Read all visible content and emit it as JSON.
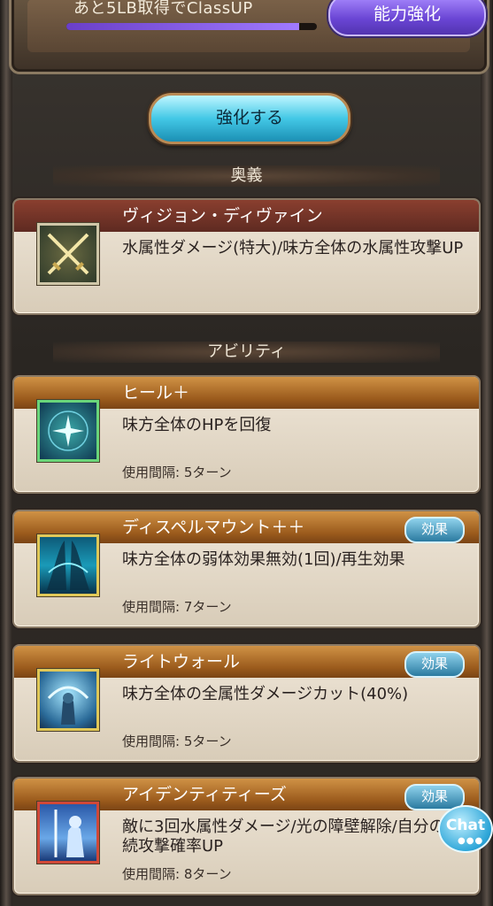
{
  "top": {
    "class_up_text": "あと5LB取得でClassUP",
    "progress_fraction": 0.93,
    "ability_button_label": "能力強化"
  },
  "enhance_button_label": "強化する",
  "sections": {
    "ougi_title": "奥義",
    "ability_title": "アビリティ"
  },
  "ougi": {
    "name": "ヴィジョン・ディヴァイン",
    "description": "水属性ダメージ(特大)/味方全体の水属性攻撃UP",
    "icon": "crossed-swords-icon"
  },
  "abilities": [
    {
      "name": "ヒール＋",
      "description": "味方全体のHPを回復",
      "interval": "使用間隔: 5ターン",
      "icon": "heal-sparkle-icon",
      "has_effect_button": false
    },
    {
      "name": "ディスペルマウント＋＋",
      "description": "味方全体の弱体効果無効(1回)/再生効果",
      "interval": "使用間隔: 7ターン",
      "icon": "dispel-mount-icon",
      "has_effect_button": true
    },
    {
      "name": "ライトウォール",
      "description": "味方全体の全属性ダメージカット(40%)",
      "interval": "使用間隔: 5ターン",
      "icon": "light-wall-icon",
      "has_effect_button": true
    },
    {
      "name": "アイデンティティーズ",
      "description": "敵に3回水属性ダメージ/光の障壁解除/自分の連続攻撃確率UP",
      "interval": "使用間隔: 8ターン",
      "icon": "identities-icon",
      "has_effect_button": true
    }
  ],
  "effect_button_label": "効果",
  "chat_label": "Chat",
  "colors": {
    "ougi_header": "#7a3a2c",
    "ability_header": "#b06f2a",
    "enhance_button": "#43c8e6",
    "ability_button": "#6a45d4"
  }
}
